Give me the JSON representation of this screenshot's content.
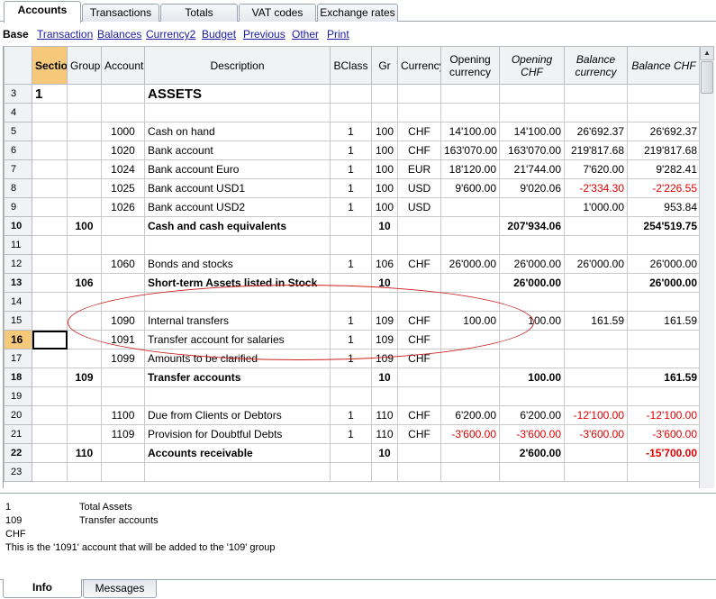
{
  "tabs": [
    "Accounts",
    "Transactions",
    "Totals",
    "VAT codes",
    "Exchange rates"
  ],
  "view": {
    "current": "Base",
    "links": [
      "Transaction",
      "Balances",
      "Currency2",
      "Budget",
      "Previous",
      "Other",
      "Print"
    ]
  },
  "columns": {
    "section": "Section",
    "group": "Group",
    "account": "Account",
    "description": "Description",
    "bclass": "BClass",
    "gr": "Gr",
    "currency": "Currency",
    "opening_currency_1": "Opening",
    "opening_currency_2": "currency",
    "opening_chf_1": "Opening",
    "opening_chf_2": "CHF",
    "balance_currency_1": "Balance",
    "balance_currency_2": "currency",
    "balance_chf": "Balance CHF"
  },
  "rows": [
    {
      "n": "3",
      "section": "1",
      "group": "",
      "account": "",
      "description": "ASSETS",
      "bclass": "",
      "gr": "",
      "currency": "",
      "open_cur": "",
      "open_chf": "",
      "bal_cur": "",
      "bal_chf": ""
    },
    {
      "n": "4",
      "section": "",
      "group": "",
      "account": "",
      "description": "",
      "bclass": "",
      "gr": "",
      "currency": "",
      "open_cur": "",
      "open_chf": "",
      "bal_cur": "",
      "bal_chf": ""
    },
    {
      "n": "5",
      "section": "",
      "group": "",
      "account": "1000",
      "description": "Cash on hand",
      "bclass": "1",
      "gr": "100",
      "currency": "CHF",
      "open_cur": "14'100.00",
      "open_chf": "14'100.00",
      "bal_cur": "26'692.37",
      "bal_chf": "26'692.37"
    },
    {
      "n": "6",
      "section": "",
      "group": "",
      "account": "1020",
      "description": "Bank account",
      "bclass": "1",
      "gr": "100",
      "currency": "CHF",
      "open_cur": "163'070.00",
      "open_chf": "163'070.00",
      "bal_cur": "219'817.68",
      "bal_chf": "219'817.68"
    },
    {
      "n": "7",
      "section": "",
      "group": "",
      "account": "1024",
      "description": "Bank account Euro",
      "bclass": "1",
      "gr": "100",
      "currency": "EUR",
      "open_cur": "18'120.00",
      "open_chf": "21'744.00",
      "bal_cur": "7'620.00",
      "bal_chf": "9'282.41"
    },
    {
      "n": "8",
      "section": "",
      "group": "",
      "account": "1025",
      "description": "Bank account USD1",
      "bclass": "1",
      "gr": "100",
      "currency": "USD",
      "open_cur": "9'600.00",
      "open_chf": "9'020.06",
      "bal_cur": "-2'334.30",
      "bal_chf": "-2'226.55"
    },
    {
      "n": "9",
      "section": "",
      "group": "",
      "account": "1026",
      "description": "Bank account USD2",
      "bclass": "1",
      "gr": "100",
      "currency": "USD",
      "open_cur": "",
      "open_chf": "",
      "bal_cur": "1'000.00",
      "bal_chf": "953.84"
    },
    {
      "n": "10",
      "section": "",
      "group": "100",
      "account": "",
      "description": "Cash and cash equivalents",
      "bclass": "",
      "gr": "10",
      "currency": "",
      "open_cur": "",
      "open_chf": "207'934.06",
      "bal_cur": "",
      "bal_chf": "254'519.75"
    },
    {
      "n": "11",
      "section": "",
      "group": "",
      "account": "",
      "description": "",
      "bclass": "",
      "gr": "",
      "currency": "",
      "open_cur": "",
      "open_chf": "",
      "bal_cur": "",
      "bal_chf": ""
    },
    {
      "n": "12",
      "section": "",
      "group": "",
      "account": "1060",
      "description": "Bonds and stocks",
      "bclass": "1",
      "gr": "106",
      "currency": "CHF",
      "open_cur": "26'000.00",
      "open_chf": "26'000.00",
      "bal_cur": "26'000.00",
      "bal_chf": "26'000.00"
    },
    {
      "n": "13",
      "section": "",
      "group": "106",
      "account": "",
      "description": "Short-term Assets listed in Stock",
      "bclass": "",
      "gr": "10",
      "currency": "",
      "open_cur": "",
      "open_chf": "26'000.00",
      "bal_cur": "",
      "bal_chf": "26'000.00"
    },
    {
      "n": "14",
      "section": "",
      "group": "",
      "account": "",
      "description": "",
      "bclass": "",
      "gr": "",
      "currency": "",
      "open_cur": "",
      "open_chf": "",
      "bal_cur": "",
      "bal_chf": ""
    },
    {
      "n": "15",
      "section": "",
      "group": "",
      "account": "1090",
      "description": "Internal transfers",
      "bclass": "1",
      "gr": "109",
      "currency": "CHF",
      "open_cur": "100.00",
      "open_chf": "100.00",
      "bal_cur": "161.59",
      "bal_chf": "161.59"
    },
    {
      "n": "16",
      "section": "",
      "group": "",
      "account": "1091",
      "description": "Transfer account for salaries",
      "bclass": "1",
      "gr": "109",
      "currency": "CHF",
      "open_cur": "",
      "open_chf": "",
      "bal_cur": "",
      "bal_chf": ""
    },
    {
      "n": "17",
      "section": "",
      "group": "",
      "account": "1099",
      "description": "Amounts to be clarified",
      "bclass": "1",
      "gr": "109",
      "currency": "CHF",
      "open_cur": "",
      "open_chf": "",
      "bal_cur": "",
      "bal_chf": ""
    },
    {
      "n": "18",
      "section": "",
      "group": "109",
      "account": "",
      "description": "Transfer accounts",
      "bclass": "",
      "gr": "10",
      "currency": "",
      "open_cur": "",
      "open_chf": "100.00",
      "bal_cur": "",
      "bal_chf": "161.59"
    },
    {
      "n": "19",
      "section": "",
      "group": "",
      "account": "",
      "description": "",
      "bclass": "",
      "gr": "",
      "currency": "",
      "open_cur": "",
      "open_chf": "",
      "bal_cur": "",
      "bal_chf": ""
    },
    {
      "n": "20",
      "section": "",
      "group": "",
      "account": "1100",
      "description": "Due from Clients or Debtors",
      "bclass": "1",
      "gr": "110",
      "currency": "CHF",
      "open_cur": "6'200.00",
      "open_chf": "6'200.00",
      "bal_cur": "-12'100.00",
      "bal_chf": "-12'100.00"
    },
    {
      "n": "21",
      "section": "",
      "group": "",
      "account": "1109",
      "description": "Provision for Doubtful Debts",
      "bclass": "1",
      "gr": "110",
      "currency": "CHF",
      "open_cur": "-3'600.00",
      "open_chf": "-3'600.00",
      "bal_cur": "-3'600.00",
      "bal_chf": "-3'600.00"
    },
    {
      "n": "22",
      "section": "",
      "group": "110",
      "account": "",
      "description": "Accounts receivable",
      "bclass": "",
      "gr": "10",
      "currency": "",
      "open_cur": "",
      "open_chf": "2'600.00",
      "bal_cur": "",
      "bal_chf": "-15'700.00"
    },
    {
      "n": "23",
      "section": "",
      "group": "",
      "account": "",
      "description": "",
      "bclass": "",
      "gr": "",
      "currency": "",
      "open_cur": "",
      "open_chf": "",
      "bal_cur": "",
      "bal_chf": ""
    }
  ],
  "info": [
    {
      "k": "1",
      "v": "Total Assets"
    },
    {
      "k": "109",
      "v": "Transfer accounts"
    },
    {
      "k": "CHF",
      "v": ""
    },
    {
      "k": "This is the '1091' account that will be added to the '109' group",
      "v": ""
    }
  ],
  "bottom_tabs": [
    "Info",
    "Messages"
  ],
  "colors": {
    "negative": "#e00000",
    "selection": "#f6c97a",
    "annotation": "#cc1f1f",
    "link": "#1a1aa6"
  }
}
